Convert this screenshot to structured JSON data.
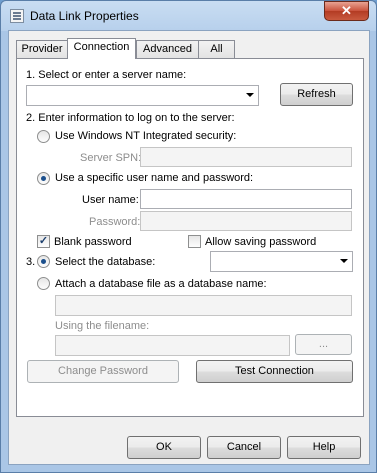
{
  "window": {
    "title": "Data Link Properties",
    "close_glyph": "✕"
  },
  "tabs": [
    {
      "label": "Provider"
    },
    {
      "label": "Connection"
    },
    {
      "label": "Advanced"
    },
    {
      "label": "All"
    }
  ],
  "section1": {
    "label": "1. Select or enter a server name:",
    "server_value": "",
    "refresh_label": "Refresh"
  },
  "section2": {
    "label": "2. Enter information to log on to the server:",
    "radio_windows_nt": "Use Windows NT Integrated security:",
    "server_spn_label": "Server SPN:",
    "server_spn_value": "",
    "radio_specific": "Use a specific user name and password:",
    "user_name_label": "User name:",
    "user_name_value": "",
    "password_label": "Password:",
    "password_value": "",
    "blank_password_label": "Blank password",
    "blank_password_checked": true,
    "allow_saving_label": "Allow saving password",
    "allow_saving_checked": false
  },
  "section3": {
    "number": "3.",
    "radio_select_db": "Select the database:",
    "database_value": "",
    "radio_attach": "Attach a database file as a database name:",
    "attach_value": "",
    "filename_label": "Using the filename:",
    "filename_value": "",
    "browse_label": "..."
  },
  "buttons": {
    "change_password": "Change Password",
    "test_connection": "Test Connection",
    "ok": "OK",
    "cancel": "Cancel",
    "help": "Help"
  }
}
